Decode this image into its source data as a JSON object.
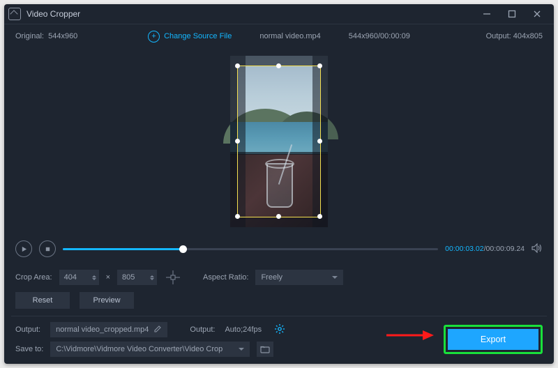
{
  "titlebar": {
    "title": "Video Cropper"
  },
  "infobar": {
    "original_label": "Original:",
    "original_value": "544x960",
    "change_source": "Change Source File",
    "filename": "normal video.mp4",
    "src_meta": "544x960/00:00:09",
    "output_label": "Output:",
    "output_value": "404x805"
  },
  "player": {
    "current_time": "00:00:03.02",
    "total_time": "00:00:09.24"
  },
  "crop": {
    "area_label": "Crop Area:",
    "width": "404",
    "height": "805",
    "times": "×",
    "aspect_label": "Aspect Ratio:",
    "aspect_value": "Freely"
  },
  "buttons": {
    "reset": "Reset",
    "preview": "Preview",
    "export": "Export"
  },
  "output": {
    "label": "Output:",
    "filename": "normal video_cropped.mp4",
    "fmt_label": "Output:",
    "fmt_value": "Auto;24fps"
  },
  "save": {
    "label": "Save to:",
    "path": "C:\\Vidmore\\Vidmore Video Converter\\Video Crop"
  }
}
